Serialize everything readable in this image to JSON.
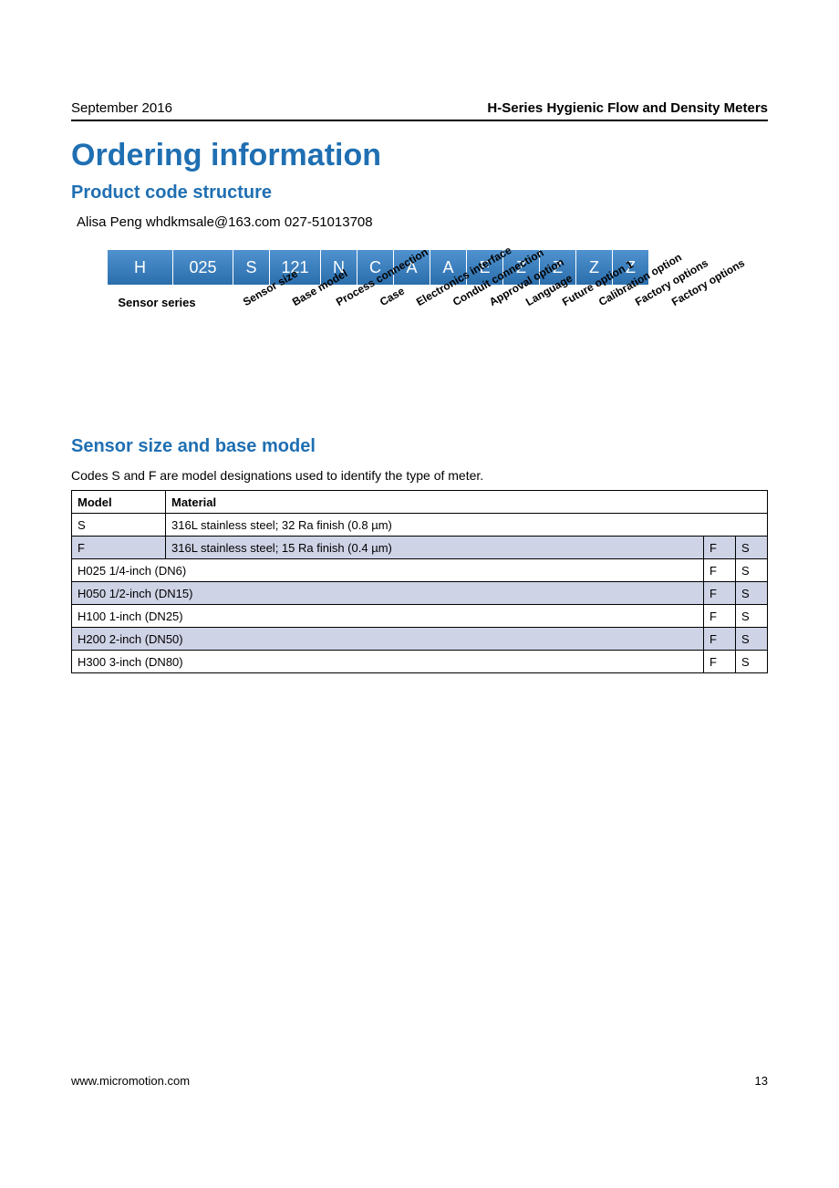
{
  "header": {
    "date": "September 2016",
    "title": "H-Series Hygienic Flow and Density Meters"
  },
  "h1": "Ordering information",
  "h2_structure": "Product code structure",
  "contact": "Alisa Peng  whdkmsale@163.com  027-51013708",
  "code": {
    "boxes": [
      "H",
      "025",
      "S",
      "121",
      "N",
      "C",
      "A",
      "A",
      "E",
      "Z",
      "Z",
      "Z",
      "Z"
    ],
    "first_label": "Sensor series",
    "labels": [
      "Sensor size",
      "Base model",
      "Process connection",
      "Case",
      "Electronics interface",
      "Conduit connection",
      "Approval option",
      "Language",
      "Future option 1",
      "Calibration option",
      "Factory options",
      "Factory options"
    ]
  },
  "h2_sensor": "Sensor size and base model",
  "sensor_note": "Codes S and F are model designations used to identify the type of meter.",
  "table": {
    "head": {
      "model": "Model",
      "material": "Material"
    },
    "rows": [
      {
        "model": "S",
        "material": "316L stainless steel; 32 Ra finish (0.8 µm)"
      },
      {
        "model": "F",
        "material": "316L stainless steel; 15 Ra finish (0.4 µm)"
      }
    ],
    "fs": {
      "f": "F",
      "s": "S"
    },
    "sizes": [
      "H025 1/4-inch (DN6)",
      "H050 1/2-inch (DN15)",
      "H100 1-inch (DN25)",
      "H200 2-inch (DN50)",
      "H300 3-inch (DN80)"
    ]
  },
  "footer": {
    "url": "www.micromotion.com",
    "page": "13"
  }
}
